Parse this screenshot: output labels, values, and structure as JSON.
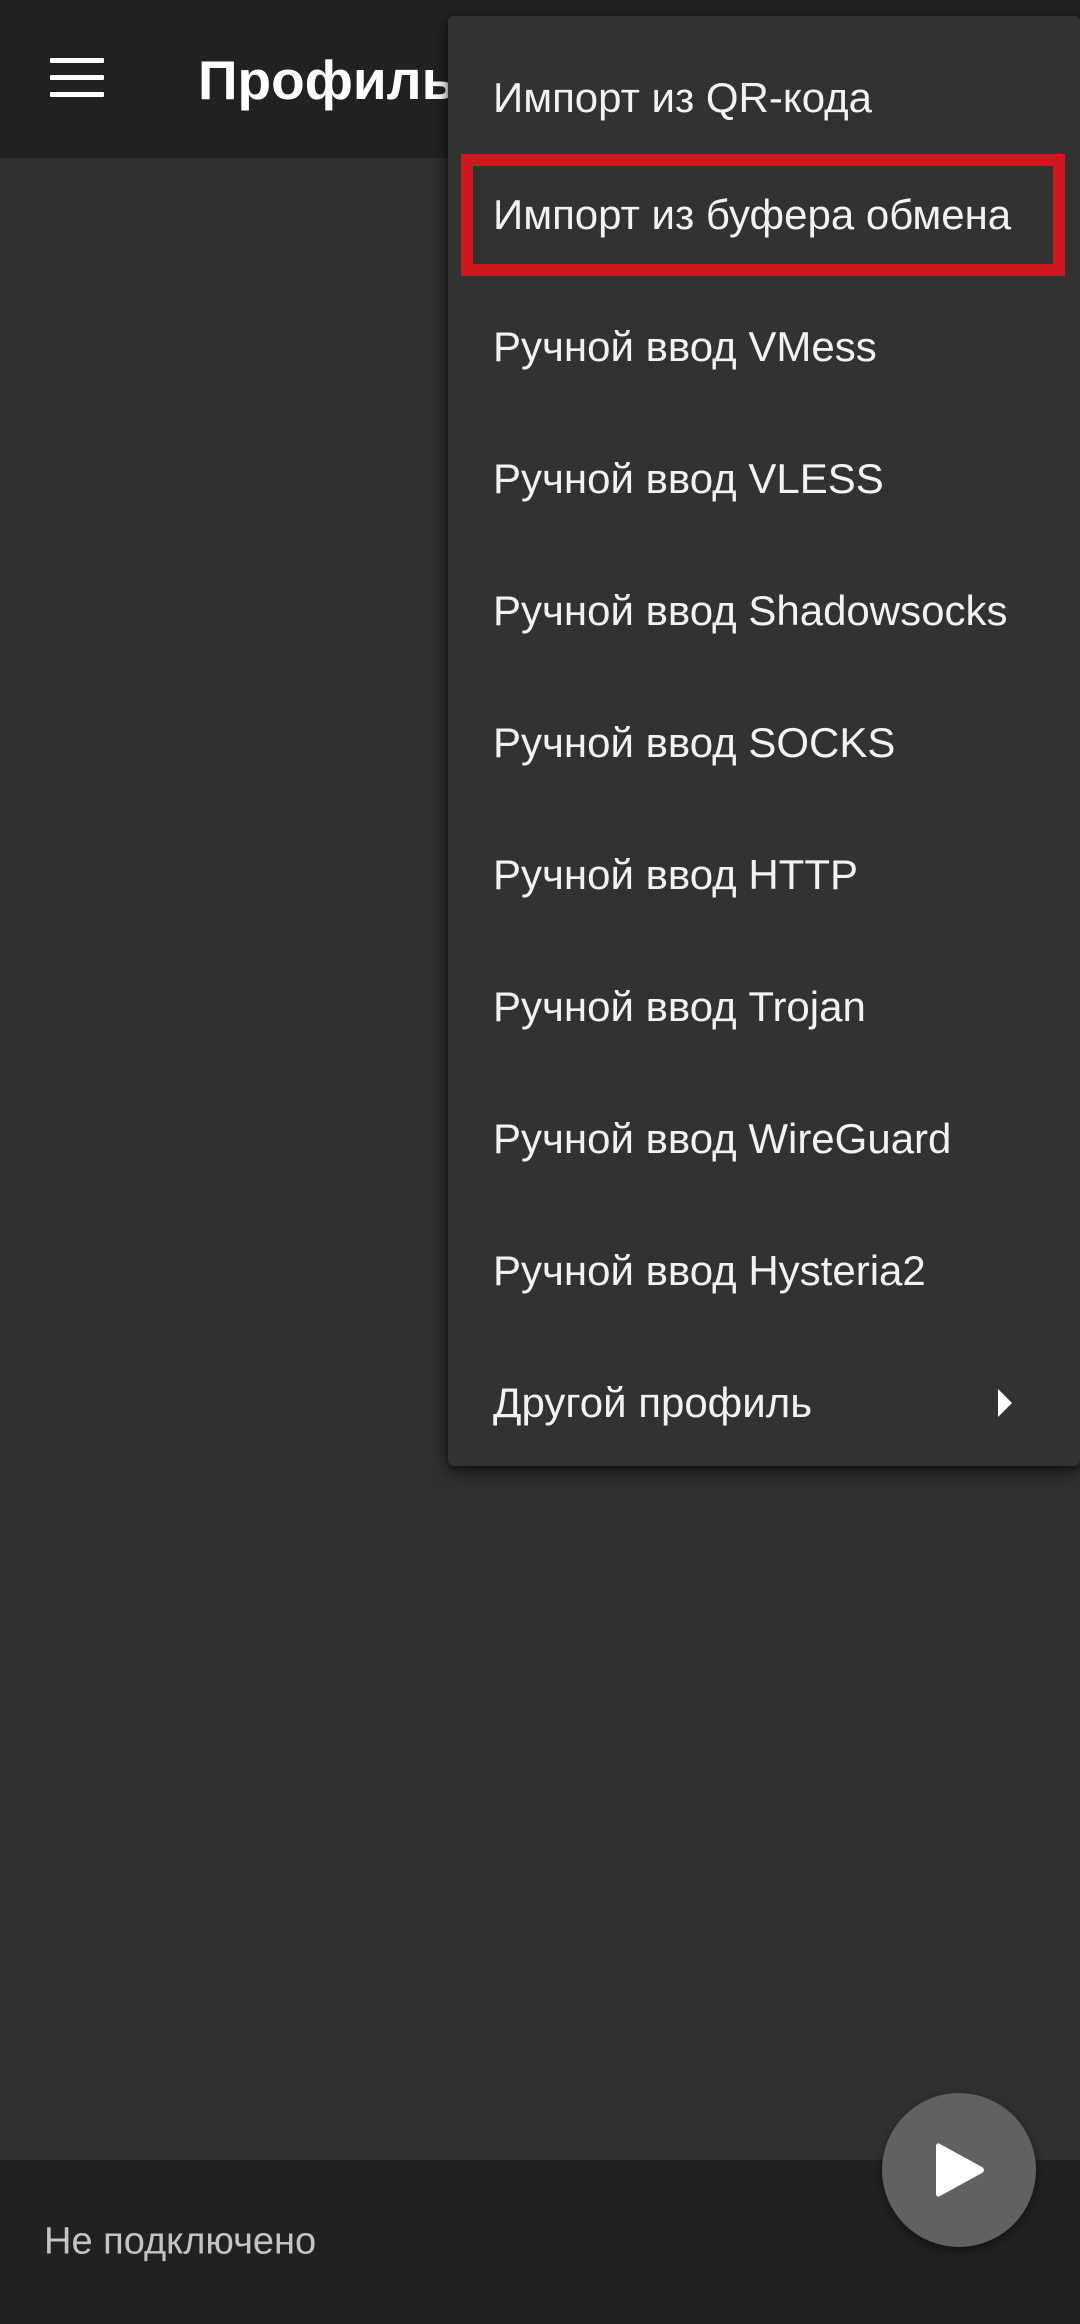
{
  "toolbar": {
    "menu_icon": "hamburger-menu-icon",
    "title": "Профиль"
  },
  "menu": {
    "items": [
      {
        "label": "Импорт из QR-кода"
      },
      {
        "label": "Импорт из буфера обмена"
      },
      {
        "label": "Ручной ввод VMess"
      },
      {
        "label": "Ручной ввод VLESS"
      },
      {
        "label": "Ручной ввод Shadowsocks"
      },
      {
        "label": "Ручной ввод SOCKS"
      },
      {
        "label": "Ручной ввод HTTP"
      },
      {
        "label": "Ручной ввод Trojan"
      },
      {
        "label": "Ручной ввод WireGuard"
      },
      {
        "label": "Ручной ввод Hysteria2"
      },
      {
        "label": "Другой профиль",
        "submenu_icon": "submenu-arrow-icon"
      }
    ],
    "highlight_color": "#d0161e"
  },
  "status": {
    "text": "Не подключено"
  },
  "fab": {
    "icon": "play-icon"
  },
  "colors": {
    "background": "#303030",
    "bars": "#212121",
    "menu": "#323232",
    "fab": "#616161"
  }
}
